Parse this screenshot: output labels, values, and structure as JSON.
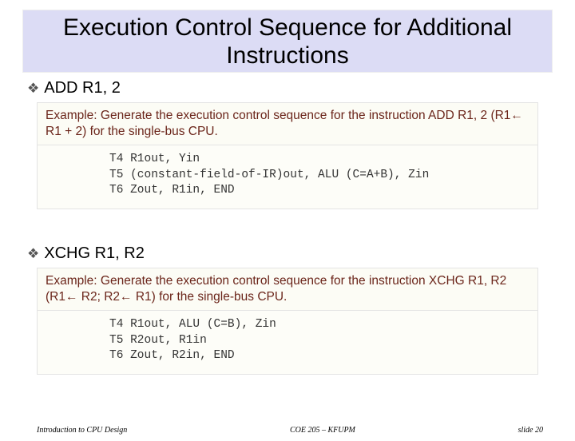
{
  "slide": {
    "title": "Execution Control Sequence for Additional Instructions",
    "bullet1": "ADD R1, 2",
    "bullet2": "XCHG R1, R2"
  },
  "example1": {
    "header": "Example: Generate the execution control sequence for the instruction ADD R1, 2 (R1← R1 + 2) for the single-bus CPU.",
    "code": "T4 R1out, Yin\nT5 (constant-field-of-IR)out, ALU (C=A+B), Zin\nT6 Zout, R1in, END"
  },
  "example2": {
    "header": "Example: Generate the execution control sequence for the instruction XCHG R1, R2 (R1← R2; R2← R1) for the single-bus CPU.",
    "code": "T4 R1out, ALU (C=B), Zin\nT5 R2out, R1in\nT6 Zout, R2in, END"
  },
  "footer": {
    "left": "Introduction to CPU Design",
    "center": "COE 205 – KFUPM",
    "right": "slide 20"
  }
}
